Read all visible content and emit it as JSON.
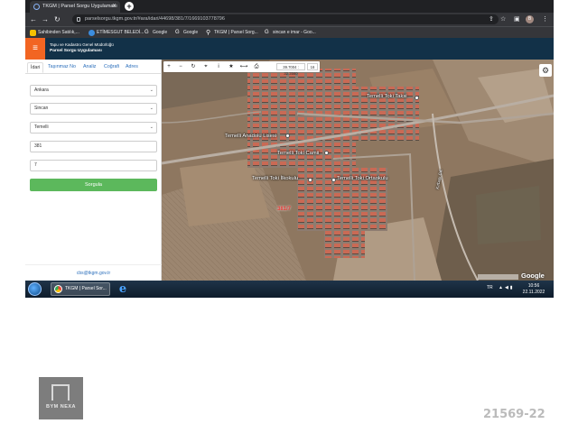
{
  "browser": {
    "tab_title": "TKGM | Parsel Sorgu Uygulaması",
    "url": "parselsorgu.tkgm.gov.tr/#ara/idari/44698/381/7/1669103778796",
    "bookmarks": [
      {
        "label": "Sahibinden Satılık,...",
        "icon_color": "#f5c200"
      },
      {
        "label": "ETİMESGUT BELEDİ...",
        "icon_color": "#3c8dde"
      },
      {
        "label": "Google",
        "icon": "G"
      },
      {
        "label": "Google",
        "icon": "G"
      },
      {
        "label": "TKGM | Parsel Sorg...",
        "icon": "pin"
      },
      {
        "label": "sincan e imar - Goo...",
        "icon": "G"
      }
    ],
    "profile_initial": "B"
  },
  "app": {
    "header_line1": "Tapu ve Kadastro Genel Müdürlüğü",
    "header_line2": "Parsel Sorgu Uygulaması",
    "accent_color": "#f26522",
    "header_color": "#123148"
  },
  "panel": {
    "tabs": [
      "İdari",
      "Taşınmaz No",
      "Analiz",
      "Coğrafi",
      "Adres"
    ],
    "active_tab": "İdari",
    "province": "Ankara",
    "district": "Sincan",
    "neighborhood": "Temelli",
    "block": "381",
    "parcel": "7",
    "submit_label": "Sorgula",
    "submit_color": "#5cb85c",
    "footer_email": "cbs@tkgm.gov.tr"
  },
  "map": {
    "coord_readout": "39.7004 : 32.3560",
    "zoom_readout": "16",
    "labels": [
      "Temelli Toki Taksi",
      "Temelli Anadolu Lisesi",
      "Temelli Toki Camii",
      "Temelli Toki İlkokulu",
      "Temelli Toki Ortaokulu",
      "Kırbaşı Cd."
    ],
    "parcel_label": "381/7",
    "provider": "Google"
  },
  "taskbar": {
    "chrome_task": "TKGM | Parsel Sor...",
    "lang": "TR",
    "time": "10:56",
    "date": "22.11.2022"
  },
  "watermark": {
    "logo_text": "BYM NEXA",
    "ref_code": "21569-22"
  }
}
